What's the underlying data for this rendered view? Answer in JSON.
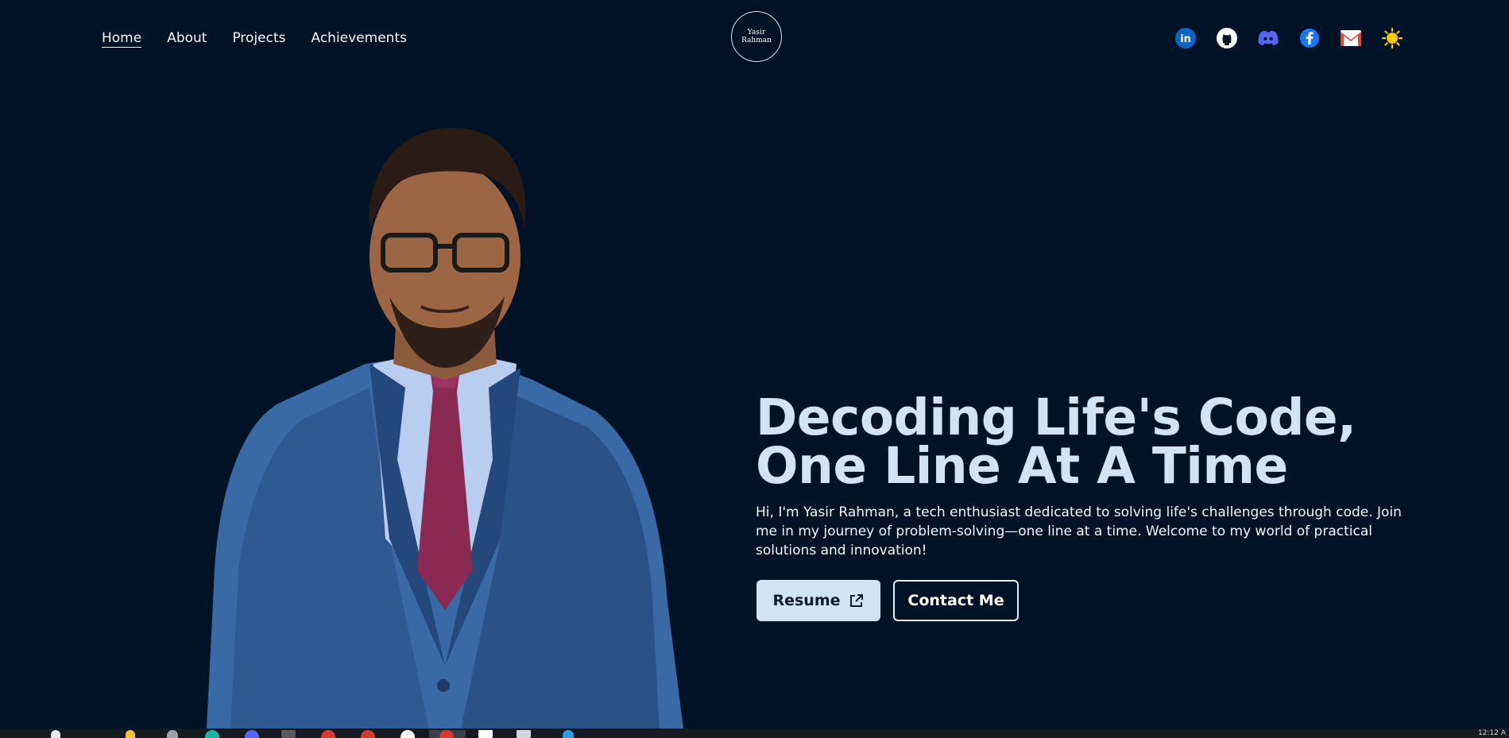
{
  "nav": {
    "items": [
      {
        "label": "Home",
        "active": true
      },
      {
        "label": "About",
        "active": false
      },
      {
        "label": "Projects",
        "active": false
      },
      {
        "label": "Achievements",
        "active": false
      }
    ]
  },
  "logo": {
    "line1": "Yasir",
    "line2": "Rahman"
  },
  "socials": [
    "linkedin-icon",
    "github-icon",
    "discord-icon",
    "facebook-icon",
    "gmail-icon",
    "sun-theme-icon"
  ],
  "hero": {
    "title_line1": "Decoding Life's Code,",
    "title_line2": "One Line At A Time",
    "description": "Hi, I'm Yasir Rahman, a tech enthusiast dedicated to solving life's challenges through code. Join me in my journey of problem-solving—one line at a time. Welcome to my world of practical solutions and innovation!",
    "resume_label": "Resume",
    "contact_label": "Contact Me"
  },
  "taskbar": {
    "time": "12:12 A"
  },
  "colors": {
    "background": "#001326",
    "accent": "#cfe4f4",
    "text": "#f2f6fb"
  }
}
